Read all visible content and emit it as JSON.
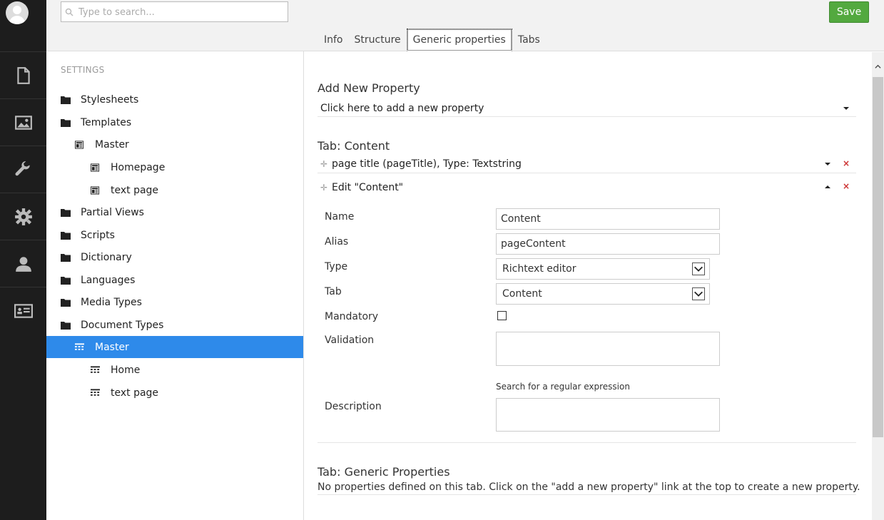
{
  "rail": {
    "items": [
      {
        "name": "content-icon"
      },
      {
        "name": "media-icon"
      },
      {
        "name": "developer-icon"
      },
      {
        "name": "settings-icon"
      },
      {
        "name": "users-icon"
      },
      {
        "name": "members-icon"
      }
    ]
  },
  "tree": {
    "search_placeholder": "Type to search...",
    "section_title": "SETTINGS",
    "nodes": [
      {
        "label": "Stylesheets",
        "icon": "folder-icon"
      },
      {
        "label": "Templates",
        "icon": "folder-icon"
      },
      {
        "label": "Master",
        "icon": "template-icon"
      },
      {
        "label": "Homepage",
        "icon": "template-icon"
      },
      {
        "label": "text page",
        "icon": "template-icon"
      },
      {
        "label": "Partial Views",
        "icon": "folder-icon"
      },
      {
        "label": "Scripts",
        "icon": "folder-icon"
      },
      {
        "label": "Dictionary",
        "icon": "folder-icon"
      },
      {
        "label": "Languages",
        "icon": "folder-icon"
      },
      {
        "label": "Media Types",
        "icon": "folder-icon"
      },
      {
        "label": "Document Types",
        "icon": "folder-icon"
      },
      {
        "label": "Master",
        "icon": "doctype-icon",
        "selected": true
      },
      {
        "label": "Home",
        "icon": "doctype-icon"
      },
      {
        "label": "text page",
        "icon": "doctype-icon"
      }
    ]
  },
  "header": {
    "save_label": "Save",
    "tabs": [
      {
        "label": "Info"
      },
      {
        "label": "Structure"
      },
      {
        "label": "Generic properties",
        "active": true
      },
      {
        "label": "Tabs"
      }
    ]
  },
  "main": {
    "add_heading": "Add New Property",
    "add_link": "Click here to add a new property",
    "tab_content_heading": "Tab: Content",
    "prop1": "page title (pageTitle), Type: Textstring",
    "prop2": "Edit \"Content\"",
    "form": {
      "name_label": "Name",
      "name_value": "Content",
      "alias_label": "Alias",
      "alias_value": "pageContent",
      "type_label": "Type",
      "type_value": "Richtext editor",
      "tab_label": "Tab",
      "tab_value": "Content",
      "mandatory_label": "Mandatory",
      "mandatory_checked": false,
      "validation_label": "Validation",
      "validation_hint": "Search for a regular expression",
      "description_label": "Description"
    },
    "generic_heading": "Tab: Generic Properties",
    "generic_note": "No properties defined on this tab. Click on the \"add a new property\" link at the top to create a new property."
  },
  "colors": {
    "rail_bg": "#1d1d1d",
    "selected_bg": "#2e8aea",
    "save_bg": "#53a93f",
    "delete_red": "#c33333"
  }
}
